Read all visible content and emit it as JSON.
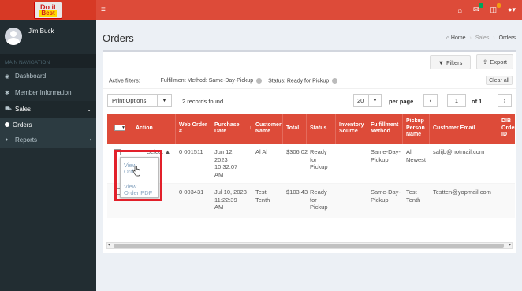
{
  "logo": {
    "line1": "Do it",
    "line2": "Best"
  },
  "user": {
    "name": "Jim Buck"
  },
  "nav": {
    "header": "MAIN NAVIGATION",
    "items": [
      {
        "label": "Dashboard",
        "icon": "dashboard-icon"
      },
      {
        "label": "Member Information",
        "icon": "gear-icon"
      },
      {
        "label": "Sales",
        "icon": "cart-icon"
      },
      {
        "label": "Reports",
        "icon": "pie-chart-icon"
      }
    ],
    "sub_orders": "Orders"
  },
  "topbar": {
    "menu_glyph": "≡"
  },
  "page": {
    "title": "Orders"
  },
  "breadcrumb": {
    "home": "Home",
    "sales": "Sales",
    "orders": "Orders"
  },
  "toolbar": {
    "filters": "Filters",
    "export": "Export"
  },
  "filters": {
    "label": "Active filters:",
    "f1": "Fulfillment Method: Same-Day-Pickup",
    "f2": "Status: Ready for Pickup",
    "clear": "Clear all"
  },
  "controls": {
    "print_options": "Print Options",
    "records": "2 records found",
    "page_size": "20",
    "per_page": "per page",
    "page_current": "1",
    "page_of": "of 1",
    "prev": "‹",
    "next": "›"
  },
  "table": {
    "headers": [
      "Action",
      "Web Order #",
      "Purchase Date",
      "Customer Name",
      "Total",
      "Status",
      "Inventory Source",
      "Fulfillment Method",
      "Pickup Person Name",
      "Customer Email",
      "DIB Order ID"
    ],
    "sort_arrow": "↓",
    "rows": [
      {
        "action": "Select ▲",
        "order": "0  001511",
        "date1": "Jun 12,",
        "date2": "2023",
        "date3": "10:32:07",
        "date4": "AM",
        "customer": "Al Al",
        "total": "$306.02",
        "status1": "Ready",
        "status2": "for",
        "status3": "Pickup",
        "inv": "",
        "fulfill1": "Same-Day-",
        "fulfill2": "Pickup",
        "pickup1": "Al",
        "pickup2": "Newest",
        "email": "salijb@hotmail.com",
        "dib": ""
      },
      {
        "action": "",
        "order": "0  003431",
        "date1": "Jul 10, 2023",
        "date2": "11:22:39",
        "date3": "AM",
        "date4": "",
        "customer": "Test",
        "customer2": "Tenth",
        "total": "$103.43",
        "status1": "Ready",
        "status2": "for",
        "status3": "Pickup",
        "inv": "",
        "fulfill1": "Same-Day-",
        "fulfill2": "Pickup",
        "pickup1": "Test",
        "pickup2": "Tenth",
        "email": "Testten@yopmail.com",
        "dib": ""
      }
    ]
  },
  "dropdown": {
    "item1a": "View",
    "item1b": "Order",
    "item2a": "View",
    "item2b": "Order PDF"
  },
  "colors": {
    "header_red": "#dd4b39",
    "sidebar": "#222d32",
    "highlight": "#e2202a"
  }
}
